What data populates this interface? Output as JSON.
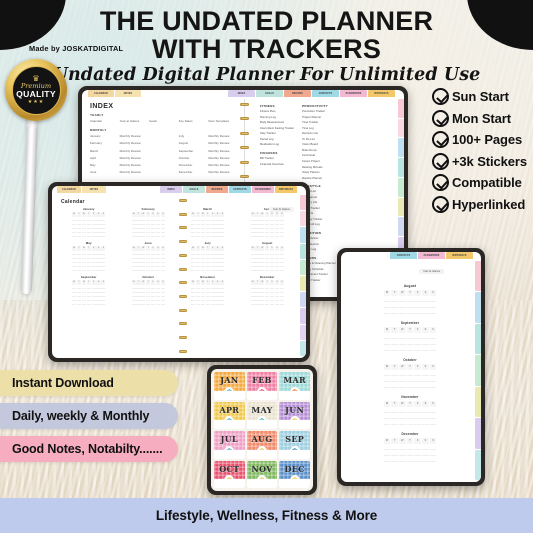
{
  "header": {
    "title_line1": "THE UNDATED PLANNER",
    "title_line2": "WITH TRACKERS",
    "subtitle": "Undated Digital Planner For Unlimited Use",
    "made_by": "Made by JOSKATDIGITAL"
  },
  "premium_badge": {
    "crown": "♛",
    "premium": "Premium",
    "quality": "QUALITY",
    "stars": "★★★"
  },
  "checklist": [
    {
      "label": "Sun Start"
    },
    {
      "label": "Mon Start"
    },
    {
      "label": "100+ Pages"
    },
    {
      "label": "+3k Stickers"
    },
    {
      "label": "Compatible"
    },
    {
      "label": "Hyperlinked"
    }
  ],
  "features": [
    {
      "label": "Instant Download",
      "color": "#eddfa8"
    },
    {
      "label": "Daily, weekly & Monthly",
      "color": "#c3c8dd"
    },
    {
      "label": "Good Notes, Notabilty.......",
      "color": "#f6adc0"
    }
  ],
  "footer": {
    "text": "Lifestyle, Wellness, Fitness & More"
  },
  "tablet_index": {
    "top_tabs_left": [
      {
        "label": "CALENDAR",
        "color": "#f3d7a0"
      },
      {
        "label": "NOTES",
        "color": "#f6e2ae"
      }
    ],
    "top_tabs_right": [
      {
        "label": "INDEX",
        "color": "#d9cdee"
      },
      {
        "label": "GOALS",
        "color": "#bfe3dd"
      },
      {
        "label": "RECIPES",
        "color": "#f0a98e"
      },
      {
        "label": "CONTACTS",
        "color": "#9fd9e6"
      },
      {
        "label": "PASSWORDS",
        "color": "#f4b9d2"
      },
      {
        "label": "BIRTHDAYS",
        "color": "#f2c86a"
      }
    ],
    "page_title": "INDEX",
    "yearly_header": "YEARLY",
    "yearly_items": [
      "Calendar",
      "Year at Glance",
      "Goals",
      "Key Dates",
      "Note Templates"
    ],
    "monthly_header": "MONTHLY",
    "monthly_rows": [
      {
        "month": "January",
        "link": "Monthly Review",
        "month2": "July",
        "link2": "Monthly Review"
      },
      {
        "month": "February",
        "link": "Monthly Review",
        "month2": "August",
        "link2": "Monthly Review"
      },
      {
        "month": "March",
        "link": "Monthly Review",
        "month2": "September",
        "link2": "Monthly Review"
      },
      {
        "month": "April",
        "link": "Monthly Review",
        "month2": "October",
        "link2": "Monthly Review"
      },
      {
        "month": "May",
        "link": "Monthly Review",
        "month2": "November",
        "link2": "Monthly Review"
      },
      {
        "month": "June",
        "link": "Monthly Review",
        "month2": "December",
        "link2": "Monthly Review"
      }
    ],
    "columns": [
      {
        "sections": [
          {
            "head": "FITNESS",
            "items": [
              "Fitness Plan",
              "Running Log",
              "Body Measurement",
              "Intermittent Fasting Tracker",
              "Step Tracker",
              "Period Log",
              "Medication Log"
            ]
          },
          {
            "head": "FINANCES",
            "items": [
              "Bill Tracker",
              "Financial Overview"
            ]
          }
        ]
      },
      {
        "sections": [
          {
            "head": "PRODUCTIVITY",
            "items": [
              "Pomodoro Tracker",
              "Project Planner",
              "Time Tracker",
              "Time Log",
              "Decision List",
              "To Do List",
              "Vision Board",
              "Brain Dump",
              "Food Goal",
              "Future Project",
              "Meeting Minutes",
              "Study Planner",
              "Routine Planner"
            ]
          },
          {
            "head": "LIFESTYLE",
            "items": [
              "Bucket List",
              "Trip Planner",
              "Grocery List",
              "Yearly Tracker",
              "Contacts",
              "Birthday Tracker",
              "Password Log"
            ]
          },
          {
            "head": "NUTRITION",
            "items": [
              "Meal Planner",
              "Food Journal",
              "Recipe Log"
            ]
          },
          {
            "head": "OTHERS",
            "items": [
              "Chores & Cleaning Planner",
              "Weekly Schedule",
              "Appointment Tracker",
              "Dream Tracker"
            ]
          }
        ]
      }
    ],
    "side_tabs": [
      "#f6c9d4",
      "#f8d9e2",
      "#bfe0f0",
      "#b9e4e0",
      "#c7ead1",
      "#e9e9b3",
      "#cfd9f2",
      "#d9ccee",
      "#e3d2f0",
      "#c4e8ea"
    ]
  },
  "tablet_calendar": {
    "top_tabs_left": [
      {
        "label": "CALENDAR",
        "color": "#f3d7a0"
      },
      {
        "label": "NOTES",
        "color": "#f6e2ae"
      }
    ],
    "top_tabs_right": [
      {
        "label": "INDEX",
        "color": "#d9cdee"
      },
      {
        "label": "GOALS",
        "color": "#bfe3dd"
      },
      {
        "label": "RECIPES",
        "color": "#f0a98e"
      },
      {
        "label": "CONTACTS",
        "color": "#9fd9e6"
      },
      {
        "label": "PASSWORDS",
        "color": "#f4b9d2"
      },
      {
        "label": "BIRTHDAYS",
        "color": "#f2c86a"
      }
    ],
    "page_title": "Calendar",
    "year_at_glance": "Year At Glance",
    "dow": [
      "M",
      "T",
      "W",
      "T",
      "F",
      "S",
      "S"
    ],
    "months": [
      "January",
      "February",
      "March",
      "April",
      "May",
      "June",
      "July",
      "August",
      "September",
      "October",
      "November",
      "December"
    ],
    "side_tabs": [
      "#f6c9d4",
      "#f8d9e2",
      "#bfe0f0",
      "#b9e4e0",
      "#c7ead1",
      "#e9e9b3",
      "#cfd9f2",
      "#d9ccee",
      "#e3d2f0",
      "#c4e8ea"
    ]
  },
  "tablet_year": {
    "top_tabs": [
      {
        "label": "CONTACTS",
        "color": "#9fd9e6"
      },
      {
        "label": "PASSWORDS",
        "color": "#f4b9d2"
      },
      {
        "label": "BIRTHDAYS",
        "color": "#f2c86a"
      }
    ],
    "year_at_glance": "Year At Glance",
    "dow": [
      "M",
      "T",
      "W",
      "T",
      "F",
      "S",
      "S"
    ],
    "months": [
      "August",
      "September",
      "October",
      "November",
      "December"
    ],
    "side_tabs": [
      "#f6c9d4",
      "#bfe0f0",
      "#b9e4e0",
      "#c7ead1",
      "#e9e9b3",
      "#d9ccee",
      "#c4e8ea"
    ]
  },
  "sticker_sheet": {
    "stickers": [
      {
        "label": "JAN",
        "bg": "#f5a93f",
        "pattern": "#ffffff",
        "flower": "#ffffff",
        "center": "#4fb3c4"
      },
      {
        "label": "FEB",
        "bg": "#ef7fa4",
        "pattern": "#ffffff",
        "flower": "#ffffff",
        "center": "#e8476f"
      },
      {
        "label": "MAR",
        "bg": "#9fd8d8",
        "pattern": "#ffffff",
        "flower": "#ffffff",
        "center": "#f07a2a"
      },
      {
        "label": "APR",
        "bg": "#f0c94a",
        "pattern": "#ffffff",
        "flower": "#ffffff",
        "center": "#4fb3c4"
      },
      {
        "label": "MAY",
        "bg": "#e9e2d0",
        "pattern": "#ffffff",
        "flower": "#ffffff",
        "center": "#4fb3c4"
      },
      {
        "label": "JUN",
        "bg": "#b48ed4",
        "pattern": "#ffffff",
        "flower": "#ffffff",
        "center": "#f0c94a"
      },
      {
        "label": "JUL",
        "bg": "#ef9ec4",
        "pattern": "#ffffff",
        "flower": "#ffffff",
        "center": "#4fb3c4"
      },
      {
        "label": "AUG",
        "bg": "#f08a6b",
        "pattern": "#ffffff",
        "flower": "#ffffff",
        "center": "#f0c94a"
      },
      {
        "label": "SEP",
        "bg": "#9ecfe0",
        "pattern": "#ffffff",
        "flower": "#ffffff",
        "center": "#3f8fb0"
      },
      {
        "label": "OCT",
        "bg": "#e8526e",
        "pattern": "#ffffff",
        "flower": "#ffffff",
        "center": "#f0c94a"
      },
      {
        "label": "NOV",
        "bg": "#7fb85f",
        "pattern": "#ffffff",
        "flower": "#ffffff",
        "center": "#f0c94a"
      },
      {
        "label": "DEC",
        "bg": "#5b8fc9",
        "pattern": "#ffffff",
        "flower": "#ffffff",
        "center": "#f0c94a"
      }
    ]
  }
}
